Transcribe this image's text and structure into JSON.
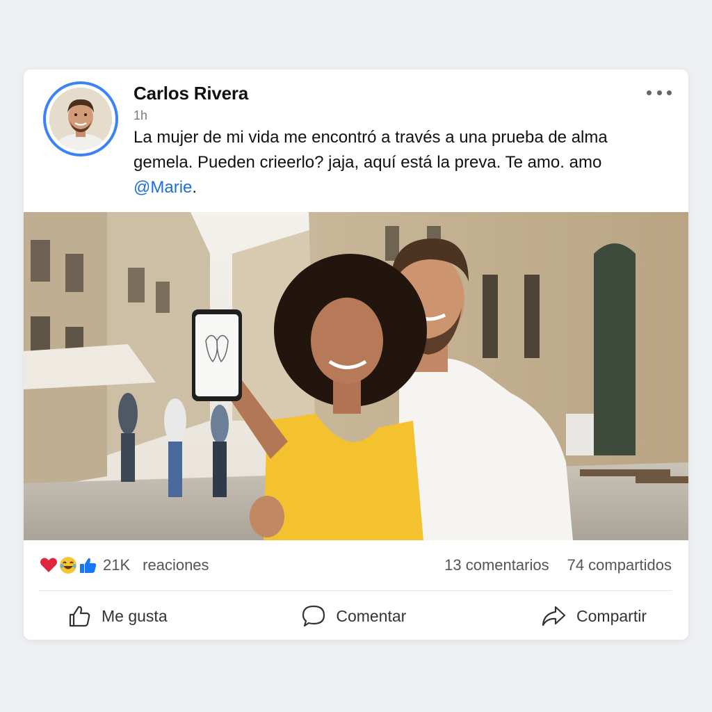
{
  "post": {
    "author": "Carlos Rivera",
    "time": "1h",
    "text_main": "La mujer de mi vida me encontró a través a una prueba de alma gemela. Pueden crieerlo? jaja,  aquí  está la preva. Te amo. amo ",
    "mention": "@Marie",
    "text_end": ".",
    "more_icon": "more-horizontal-icon"
  },
  "stats": {
    "reaction_icons": [
      "heart-icon",
      "laughing-face-icon",
      "thumbs-up-icon"
    ],
    "reaction_count": "21K",
    "reaction_word": "reaciones",
    "comments": "13 comentarios",
    "shares": "74 compartidos"
  },
  "actions": {
    "like_label": "Me gusta",
    "comment_label": "Comentar",
    "share_label": "Compartir"
  },
  "colors": {
    "accent": "#3b82f6",
    "mention": "#1d6fd8",
    "heart": "#e0263f",
    "like": "#1877f2",
    "laugh": "#f7c531"
  }
}
